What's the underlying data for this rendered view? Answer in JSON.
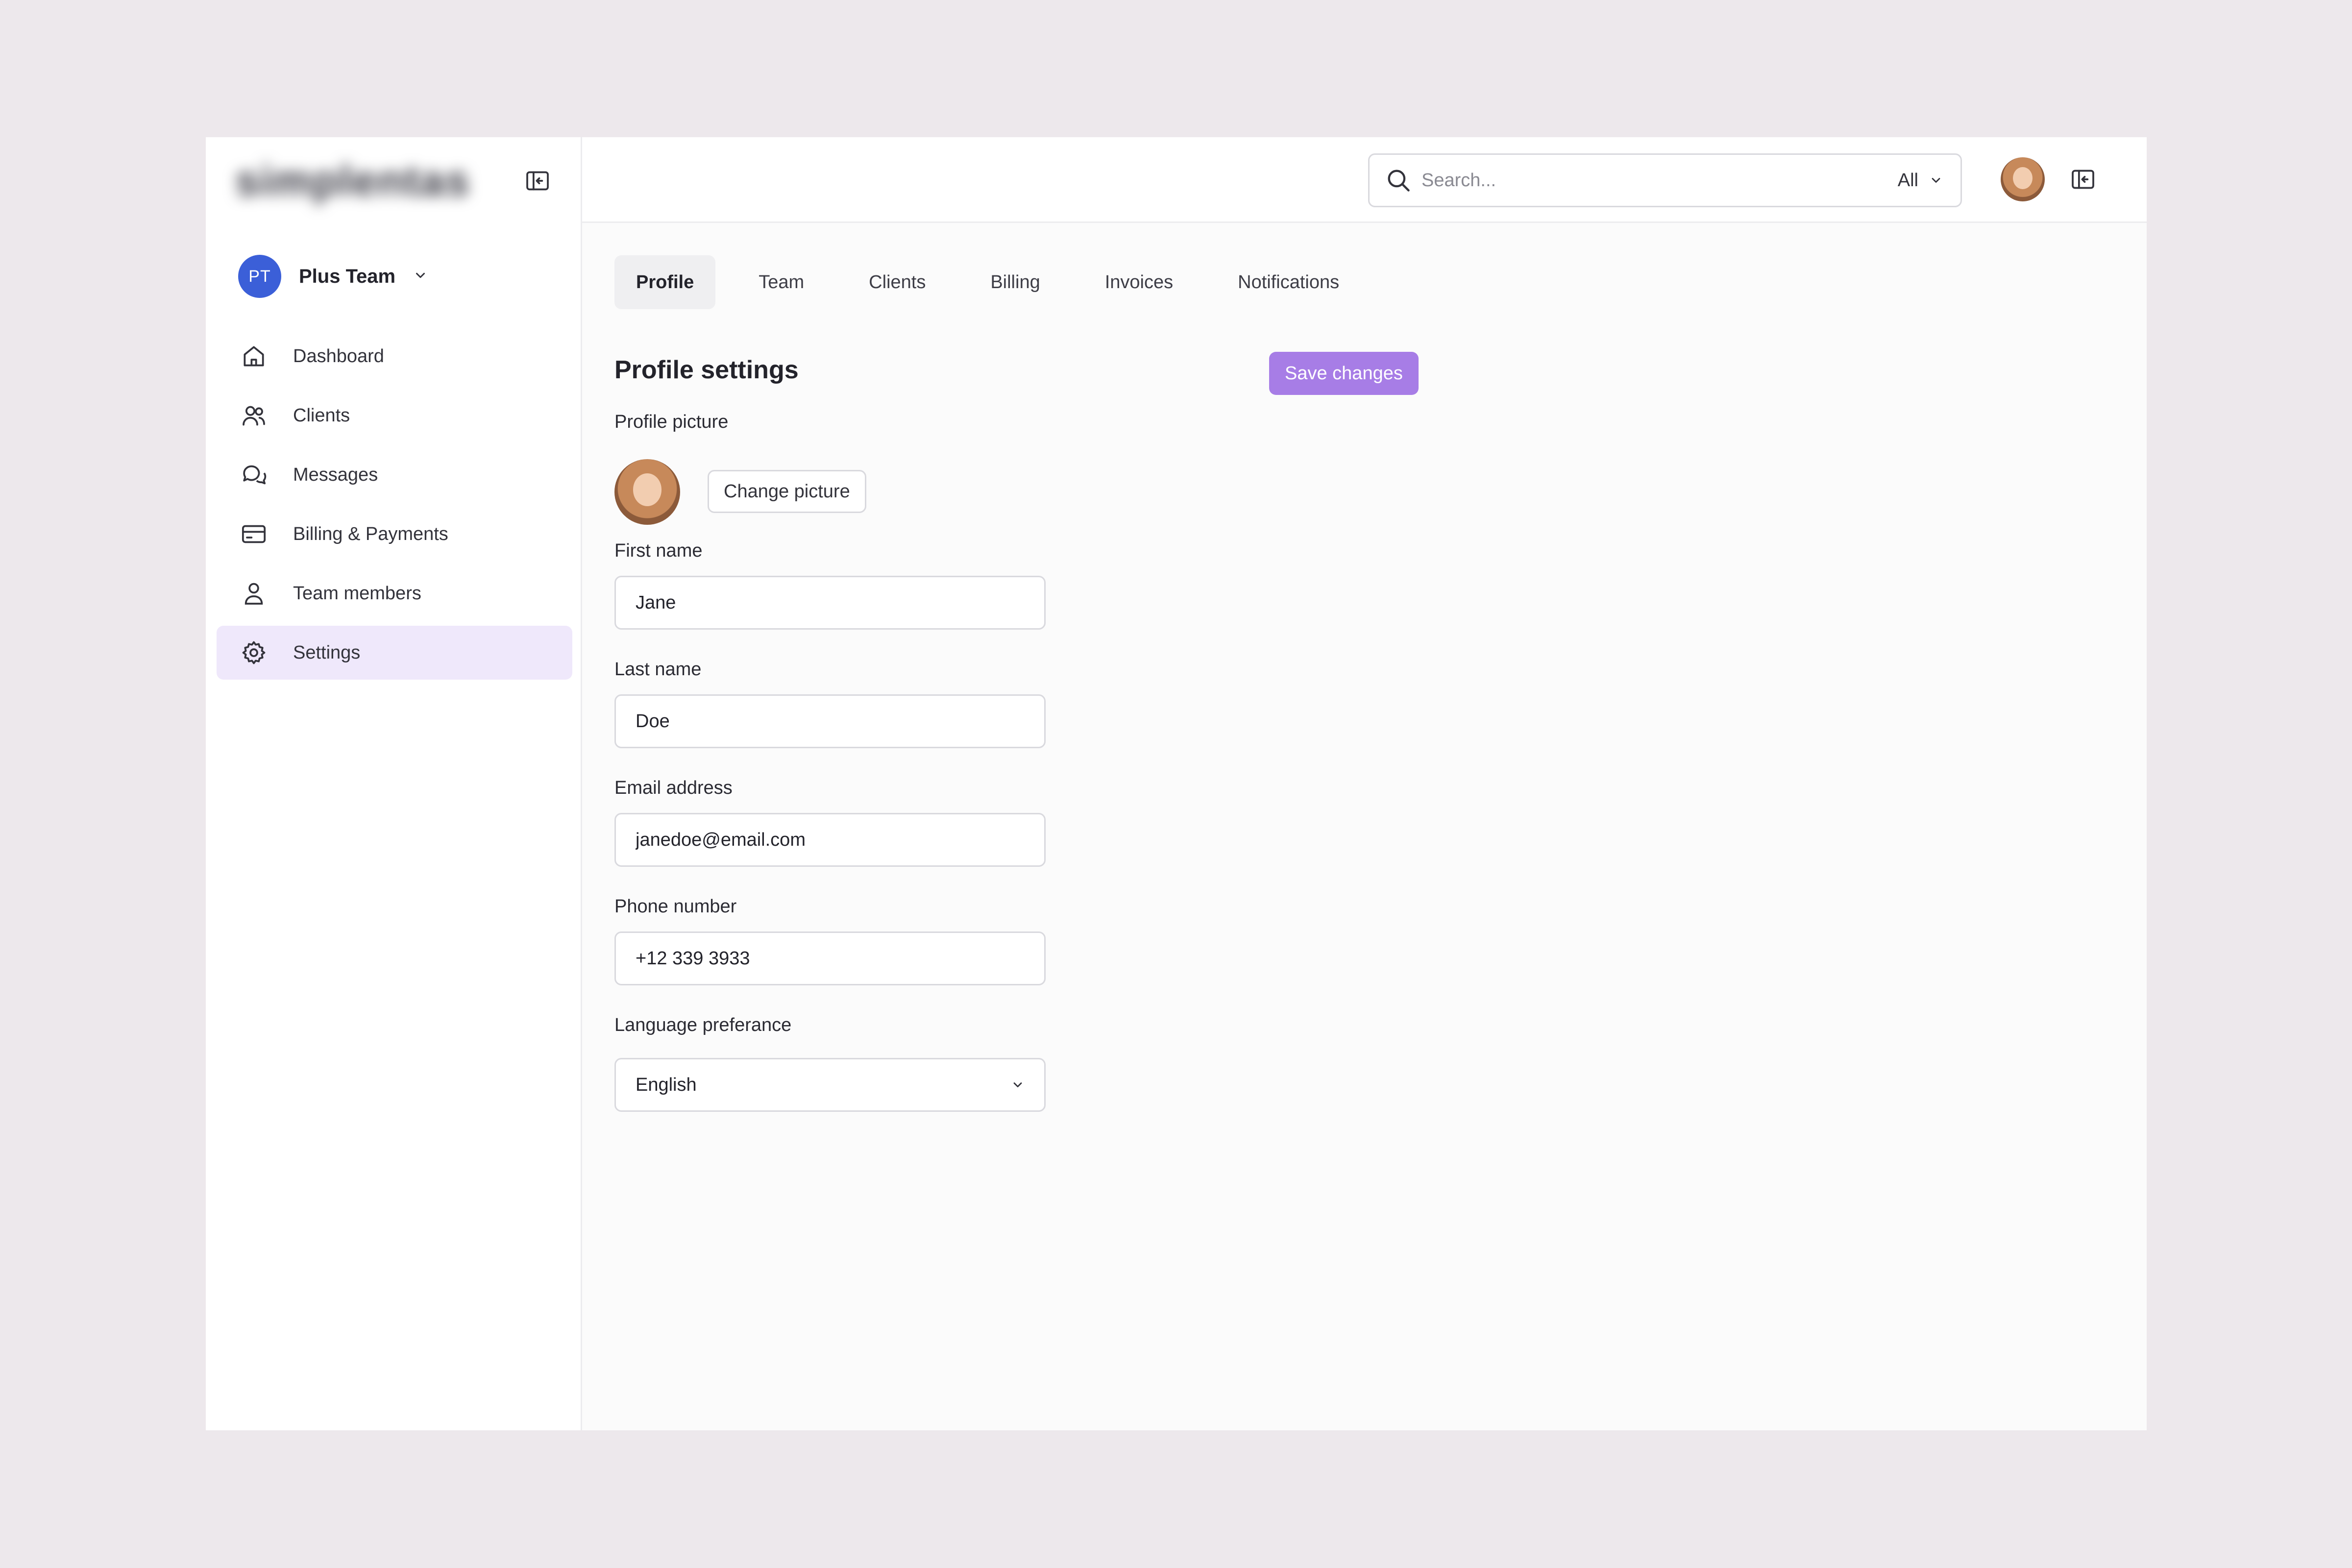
{
  "sidebar": {
    "logo": "simplentas",
    "team": {
      "initials": "PT",
      "name": "Plus Team"
    },
    "items": [
      {
        "label": "Dashboard",
        "icon": "home-icon"
      },
      {
        "label": "Clients",
        "icon": "users-icon"
      },
      {
        "label": "Messages",
        "icon": "chat-icon"
      },
      {
        "label": "Billing & Payments",
        "icon": "credit-card-icon"
      },
      {
        "label": "Team members",
        "icon": "user-icon"
      },
      {
        "label": "Settings",
        "icon": "gear-icon",
        "active": true
      }
    ]
  },
  "topbar": {
    "search_placeholder": "Search...",
    "search_scope": "All"
  },
  "tabs": [
    {
      "label": "Profile",
      "active": true
    },
    {
      "label": "Team"
    },
    {
      "label": "Clients"
    },
    {
      "label": "Billing"
    },
    {
      "label": "Invoices"
    },
    {
      "label": "Notifications"
    }
  ],
  "profile": {
    "title": "Profile settings",
    "save_label": "Save changes",
    "picture_label": "Profile picture",
    "change_picture_label": "Change picture",
    "first_name_label": "First name",
    "first_name": "Jane",
    "last_name_label": "Last name",
    "last_name": "Doe",
    "email_label": "Email address",
    "email": "janedoe@email.com",
    "phone_label": "Phone number",
    "phone": "+12 339 3933",
    "language_label": "Language preferance",
    "language": "English"
  },
  "colors": {
    "accent": "#a77de6",
    "active_nav": "#efe8fb",
    "team_avatar": "#3b5fd8"
  }
}
